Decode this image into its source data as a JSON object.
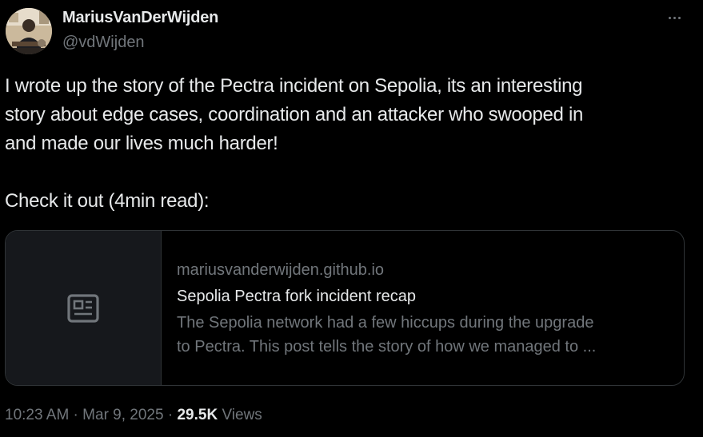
{
  "author": {
    "display_name": "MariusVanDerWijden",
    "handle": "@vdWijden",
    "avatar_icon": "user-avatar-photo"
  },
  "more_icon": "more-horizontal-icon",
  "tweet": {
    "text": "I wrote up the story of the Pectra incident on Sepolia, its an interesting\nstory about edge cases, coordination and an attacker who swooped in\nand made our lives much harder!\n\nCheck it out (4min read):"
  },
  "link_card": {
    "thumb_icon": "article-icon",
    "domain": "mariusvanderwijden.github.io",
    "title": "Sepolia Pectra fork incident recap",
    "description_line1": "The Sepolia network had a few hiccups during the upgrade",
    "description_line2": "to Pectra. This post tells the story of how we managed to ..."
  },
  "meta": {
    "time": "10:23 AM",
    "separator": " · ",
    "date": "Mar 9, 2025",
    "views_count": "29.5K",
    "views_label": "Views"
  },
  "colors": {
    "background": "#000000",
    "primary_text": "#e7e9ea",
    "secondary_text": "#71767b",
    "border": "#2f3336",
    "card_thumb_bg": "#16181c"
  }
}
